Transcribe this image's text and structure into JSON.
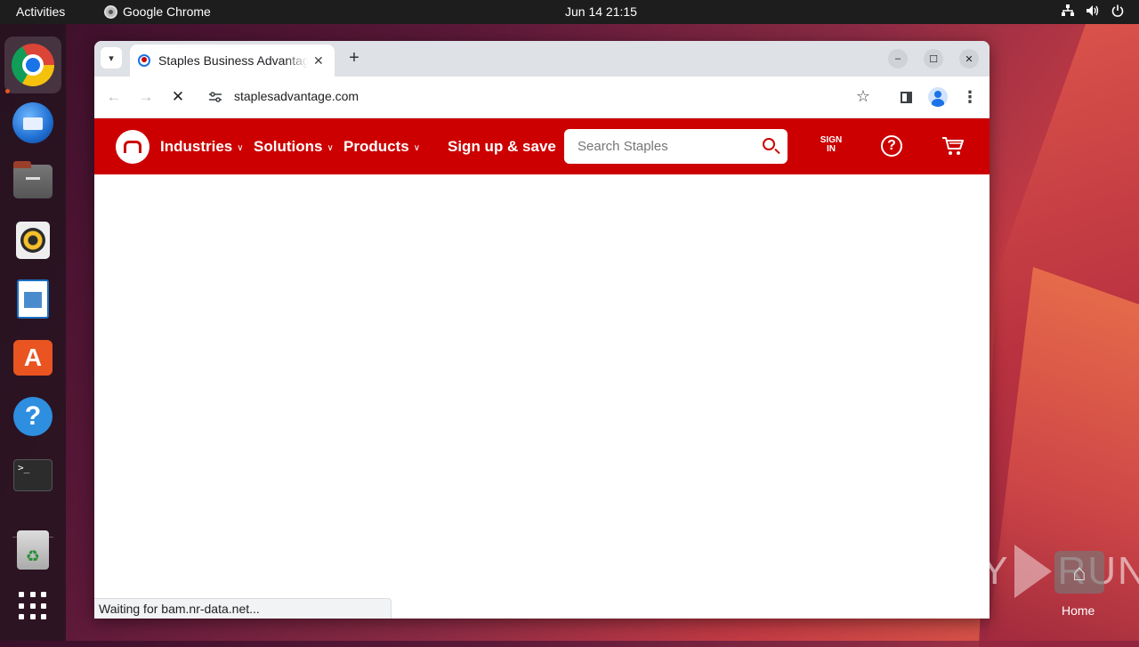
{
  "topbar": {
    "activities": "Activities",
    "app_name": "Google Chrome",
    "clock": "Jun 14  21:15",
    "tray_icons": [
      "network-icon",
      "volume-icon",
      "power-icon"
    ]
  },
  "dock": {
    "apps": [
      "Google Chrome",
      "Thunderbird Mail",
      "Files",
      "Rhythmbox",
      "LibreOffice Writer",
      "Ubuntu Software",
      "Help",
      "Terminal",
      "Trash",
      "Show Applications"
    ]
  },
  "browser": {
    "tab_title": "Staples Business Advantage",
    "new_tab_symbol": "+",
    "url": "staplesadvantage.com",
    "status_text": "Waiting for bam.nr-data.net..."
  },
  "site": {
    "nav": {
      "industries": "Industries",
      "solutions": "Solutions",
      "products": "Products",
      "signup": "Sign up & save"
    },
    "search_placeholder": "Search Staples",
    "sign_in_line1": "SIGN",
    "sign_in_line2": "IN",
    "brand_color": "#cc0000"
  },
  "desktop": {
    "watermark_left": "ANY",
    "watermark_right": "RUN",
    "home_label": "Home"
  }
}
